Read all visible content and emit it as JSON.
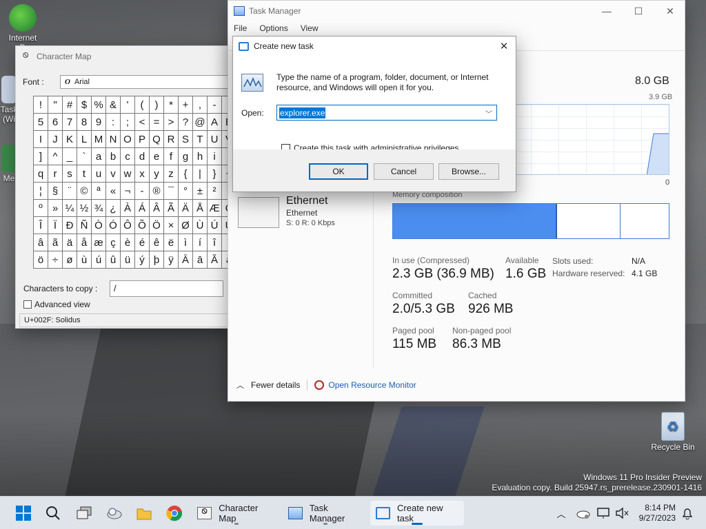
{
  "desktop": {
    "icons": [
      {
        "label": "Internet D"
      },
      {
        "label": "Task (Wi"
      },
      {
        "label": "Me"
      },
      {
        "label": "Recycle Bin"
      }
    ]
  },
  "charmap": {
    "title": "Character Map",
    "font_label": "Font :",
    "font_glyph": "O",
    "font_value": "Arial",
    "rows": [
      [
        "!",
        "\"",
        "#",
        "$",
        "%",
        "&",
        "'",
        "(",
        ")",
        "*",
        "+",
        ",",
        "-",
        "."
      ],
      [
        "5",
        "6",
        "7",
        "8",
        "9",
        ":",
        ";",
        "<",
        "=",
        ">",
        "?",
        "@",
        "A",
        "B"
      ],
      [
        "I",
        "J",
        "K",
        "L",
        "M",
        "N",
        "O",
        "P",
        "Q",
        "R",
        "S",
        "T",
        "U",
        "V"
      ],
      [
        "]",
        "^",
        "_",
        "`",
        "a",
        "b",
        "c",
        "d",
        "e",
        "f",
        "g",
        "h",
        "i",
        "j"
      ],
      [
        "q",
        "r",
        "s",
        "t",
        "u",
        "v",
        "w",
        "x",
        "y",
        "z",
        "{",
        "|",
        "}",
        "~"
      ],
      [
        "¦",
        "§",
        "¨",
        "©",
        "ª",
        "«",
        "¬",
        "-",
        "®",
        "¯",
        "°",
        "±",
        "²",
        "³"
      ],
      [
        "º",
        "»",
        "¼",
        "½",
        "¾",
        "¿",
        "À",
        "Á",
        "Â",
        "Ã",
        "Ä",
        "Å",
        "Æ",
        "Ç"
      ],
      [
        "Î",
        "Ï",
        "Đ",
        "Ñ",
        "Ò",
        "Ó",
        "Ô",
        "Õ",
        "Ö",
        "×",
        "Ø",
        "Ù",
        "Ú",
        "Û"
      ],
      [
        "â",
        "ã",
        "ä",
        "å",
        "æ",
        "ç",
        "è",
        "é",
        "ê",
        "ë",
        "ì",
        "í",
        "î",
        "ï"
      ],
      [
        "ö",
        "÷",
        "ø",
        "ù",
        "ú",
        "û",
        "ü",
        "ý",
        "þ",
        "ÿ",
        "Ā",
        "ā",
        "Ă",
        "ă"
      ]
    ],
    "copy_label": "Characters to copy :",
    "copy_value": "/",
    "advanced_label": "Advanced view",
    "status": "U+002F: Solidus"
  },
  "taskmgr": {
    "title": "Task Manager",
    "menu": [
      "File",
      "Options",
      "View"
    ],
    "mem_total": "8.0 GB",
    "mem_max": "3.9 GB",
    "mem_zero": "0",
    "composition_label": "Memory composition",
    "in_use_label": "In use (Compressed)",
    "in_use_value": "2.3 GB (36.9 MB)",
    "available_label": "Available",
    "available_value": "1.6 GB",
    "slots_label": "Slots used:",
    "slots_value": "N/A",
    "hw_label": "Hardware reserved:",
    "hw_value": "4.1 GB",
    "committed_label": "Committed",
    "committed_value": "2.0/5.3 GB",
    "cached_label": "Cached",
    "cached_value": "926 MB",
    "paged_label": "Paged pool",
    "paged_value": "115 MB",
    "nonpaged_label": "Non-paged pool",
    "nonpaged_value": "86.3 MB",
    "ethernet_name": "Ethernet",
    "ethernet_sub": "Ethernet",
    "ethernet_rate": "S: 0 R: 0 Kbps",
    "fewer_details": "Fewer details",
    "resource_monitor": "Open Resource Monitor"
  },
  "newtask": {
    "title": "Create new task",
    "description": "Type the name of a program, folder, document, or Internet resource, and Windows will open it for you.",
    "open_label": "Open:",
    "open_value": "explorer.exe",
    "admin_label": "Create this task with administrative privileges.",
    "ok": "OK",
    "cancel": "Cancel",
    "browse": "Browse..."
  },
  "watermark": {
    "line1": "Windows 11 Pro Insider Preview",
    "line2": "Evaluation copy. Build 25947.rs_prerelease.230901-1416"
  },
  "taskbar": {
    "apps": [
      {
        "label": "Character Map"
      },
      {
        "label": "Task Manager"
      },
      {
        "label": "Create new task"
      }
    ],
    "time": "8:14 PM",
    "date": "9/27/2023"
  },
  "colors": {
    "accent": "#0067c0",
    "memory_used": "#4b8ef0",
    "selection": "#0078d7"
  }
}
